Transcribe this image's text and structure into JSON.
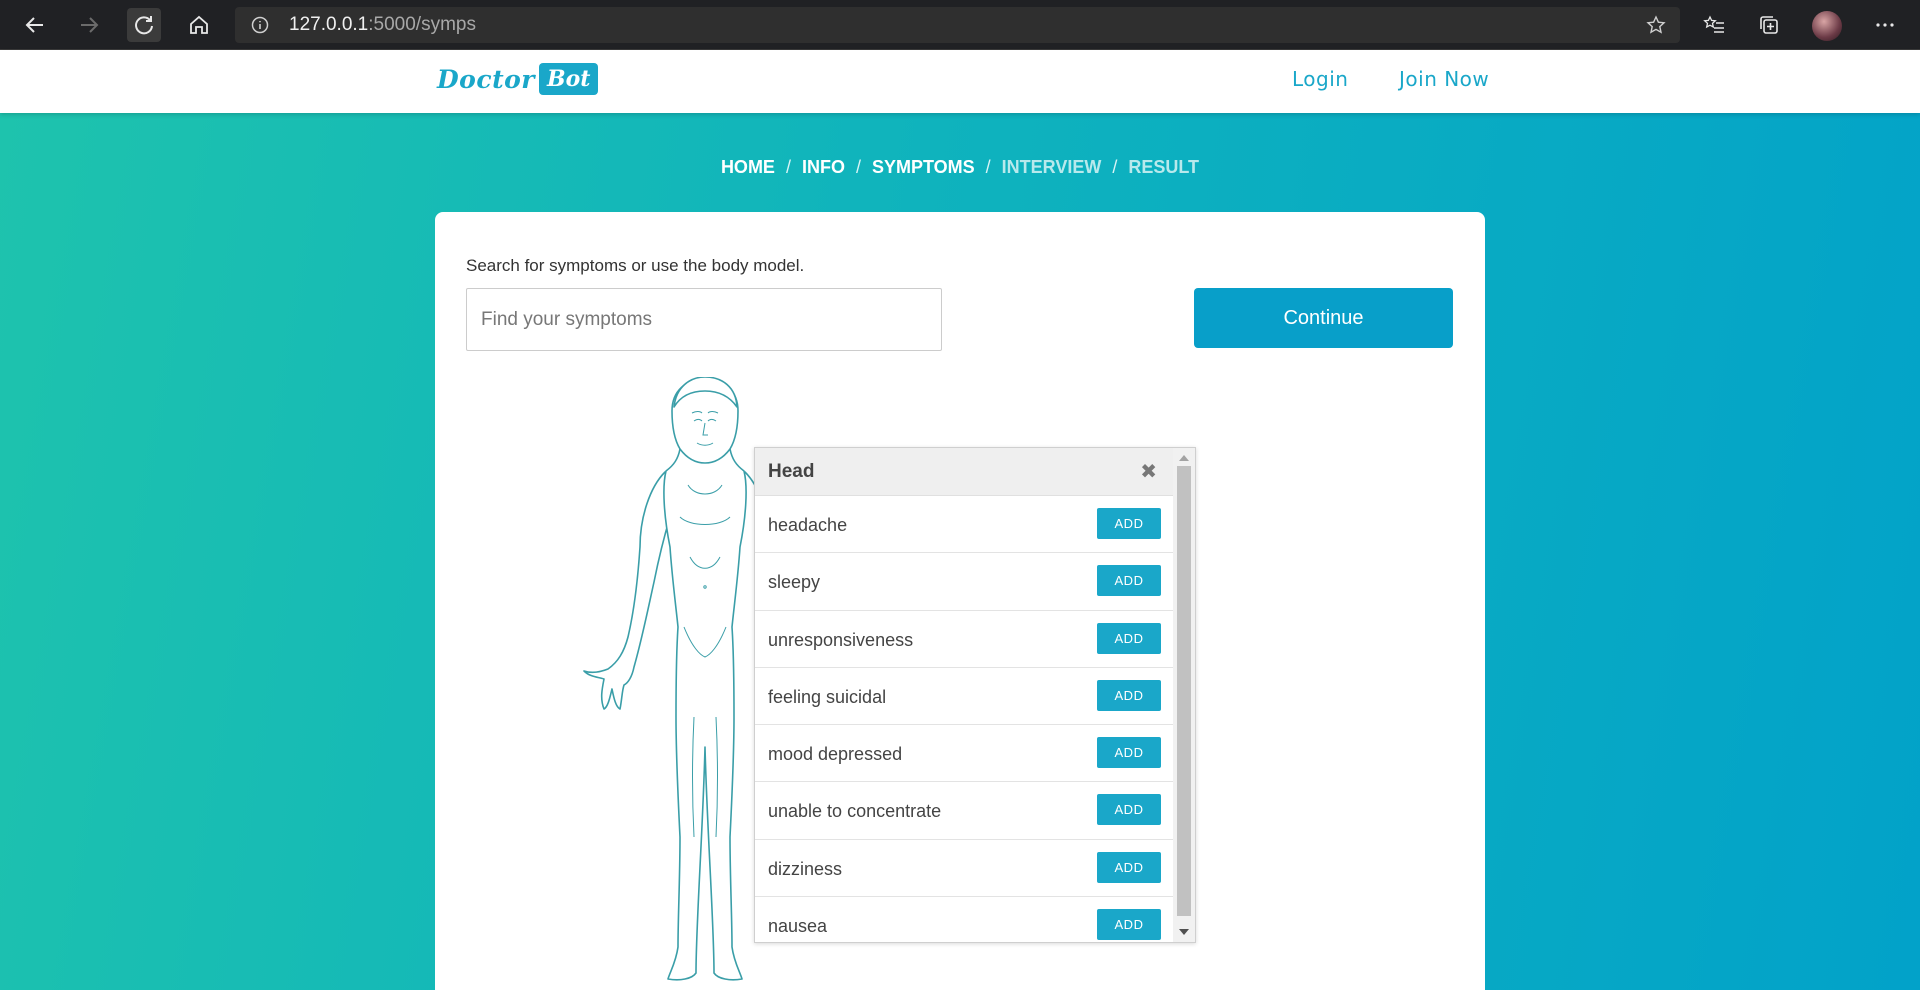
{
  "browser": {
    "url_host": "127.0.0.1",
    "url_path": ":5000/symps",
    "icons": [
      "back-arrow-icon",
      "forward-arrow-icon",
      "refresh-icon",
      "home-icon",
      "info-icon",
      "favorite-star-icon",
      "favorites-list-icon",
      "collections-icon",
      "profile-avatar",
      "more-icon"
    ]
  },
  "header": {
    "logo_doctor": "Doctor",
    "logo_bot": "Bot",
    "login": "Login",
    "join": "Join Now",
    "accent_color": "#1aa7c9"
  },
  "breadcrumb": {
    "items": [
      "HOME",
      "INFO",
      "SYMPTOMS",
      "INTERVIEW",
      "RESULT"
    ],
    "separator": "/"
  },
  "card": {
    "hint": "Search for symptoms or use the body model.",
    "search_placeholder": "Find your symptoms",
    "continue_label": "Continue"
  },
  "popup": {
    "title": "Head",
    "close_icon": "close-icon",
    "add_label": "ADD",
    "symptoms": [
      "headache",
      "sleepy",
      "unresponsiveness",
      "feeling suicidal",
      "mood depressed",
      "unable to concentrate",
      "dizziness",
      "nausea"
    ]
  }
}
